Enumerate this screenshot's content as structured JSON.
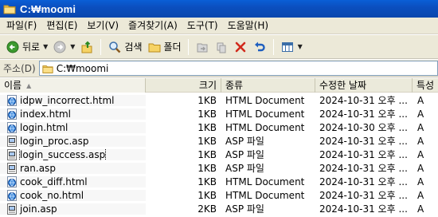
{
  "window": {
    "title": "C:₩moomi"
  },
  "menu": [
    "파일(F)",
    "편집(E)",
    "보기(V)",
    "즐겨찾기(A)",
    "도구(T)",
    "도움말(H)"
  ],
  "toolbar": {
    "back_label": "뒤로",
    "search_label": "검색",
    "folders_label": "폴더"
  },
  "address": {
    "label": "주소(D)",
    "value": "C:₩moomi"
  },
  "columns": {
    "name": "이름",
    "size": "크기",
    "type": "종류",
    "modified": "수정한 날짜",
    "attributes": "특성"
  },
  "files": [
    {
      "name": "idpw_incorrect.html",
      "size": "1KB",
      "type": "HTML Document",
      "modified": "2024-10-31 오후 ...",
      "attr": "A",
      "icon": "html-document-icon"
    },
    {
      "name": "index.html",
      "size": "1KB",
      "type": "HTML Document",
      "modified": "2024-10-31 오후 ...",
      "attr": "A",
      "icon": "html-document-icon"
    },
    {
      "name": "login.html",
      "size": "1KB",
      "type": "HTML Document",
      "modified": "2024-10-30 오후 ...",
      "attr": "A",
      "icon": "html-document-icon"
    },
    {
      "name": "login_proc.asp",
      "size": "1KB",
      "type": "ASP 파일",
      "modified": "2024-10-31 오후 ...",
      "attr": "A",
      "icon": "asp-file-icon"
    },
    {
      "name": "login_success.asp",
      "size": "1KB",
      "type": "ASP 파일",
      "modified": "2024-10-31 오후 ...",
      "attr": "A",
      "icon": "asp-file-icon",
      "focused": true
    },
    {
      "name": "ran.asp",
      "size": "1KB",
      "type": "ASP 파일",
      "modified": "2024-10-31 오후 ...",
      "attr": "A",
      "icon": "asp-file-icon"
    },
    {
      "name": "cook_diff.html",
      "size": "1KB",
      "type": "HTML Document",
      "modified": "2024-10-31 오후 ...",
      "attr": "A",
      "icon": "html-document-icon"
    },
    {
      "name": "cook_no.html",
      "size": "1KB",
      "type": "HTML Document",
      "modified": "2024-10-31 오후 ...",
      "attr": "A",
      "icon": "html-document-icon"
    },
    {
      "name": "join.asp",
      "size": "2KB",
      "type": "ASP 파일",
      "modified": "2024-10-31 오후 ...",
      "attr": "A",
      "icon": "asp-file-icon"
    }
  ],
  "colors": {
    "titlebar": "#0b4fbf",
    "chrome": "#ece9d8",
    "address_border": "#7f9db9"
  }
}
